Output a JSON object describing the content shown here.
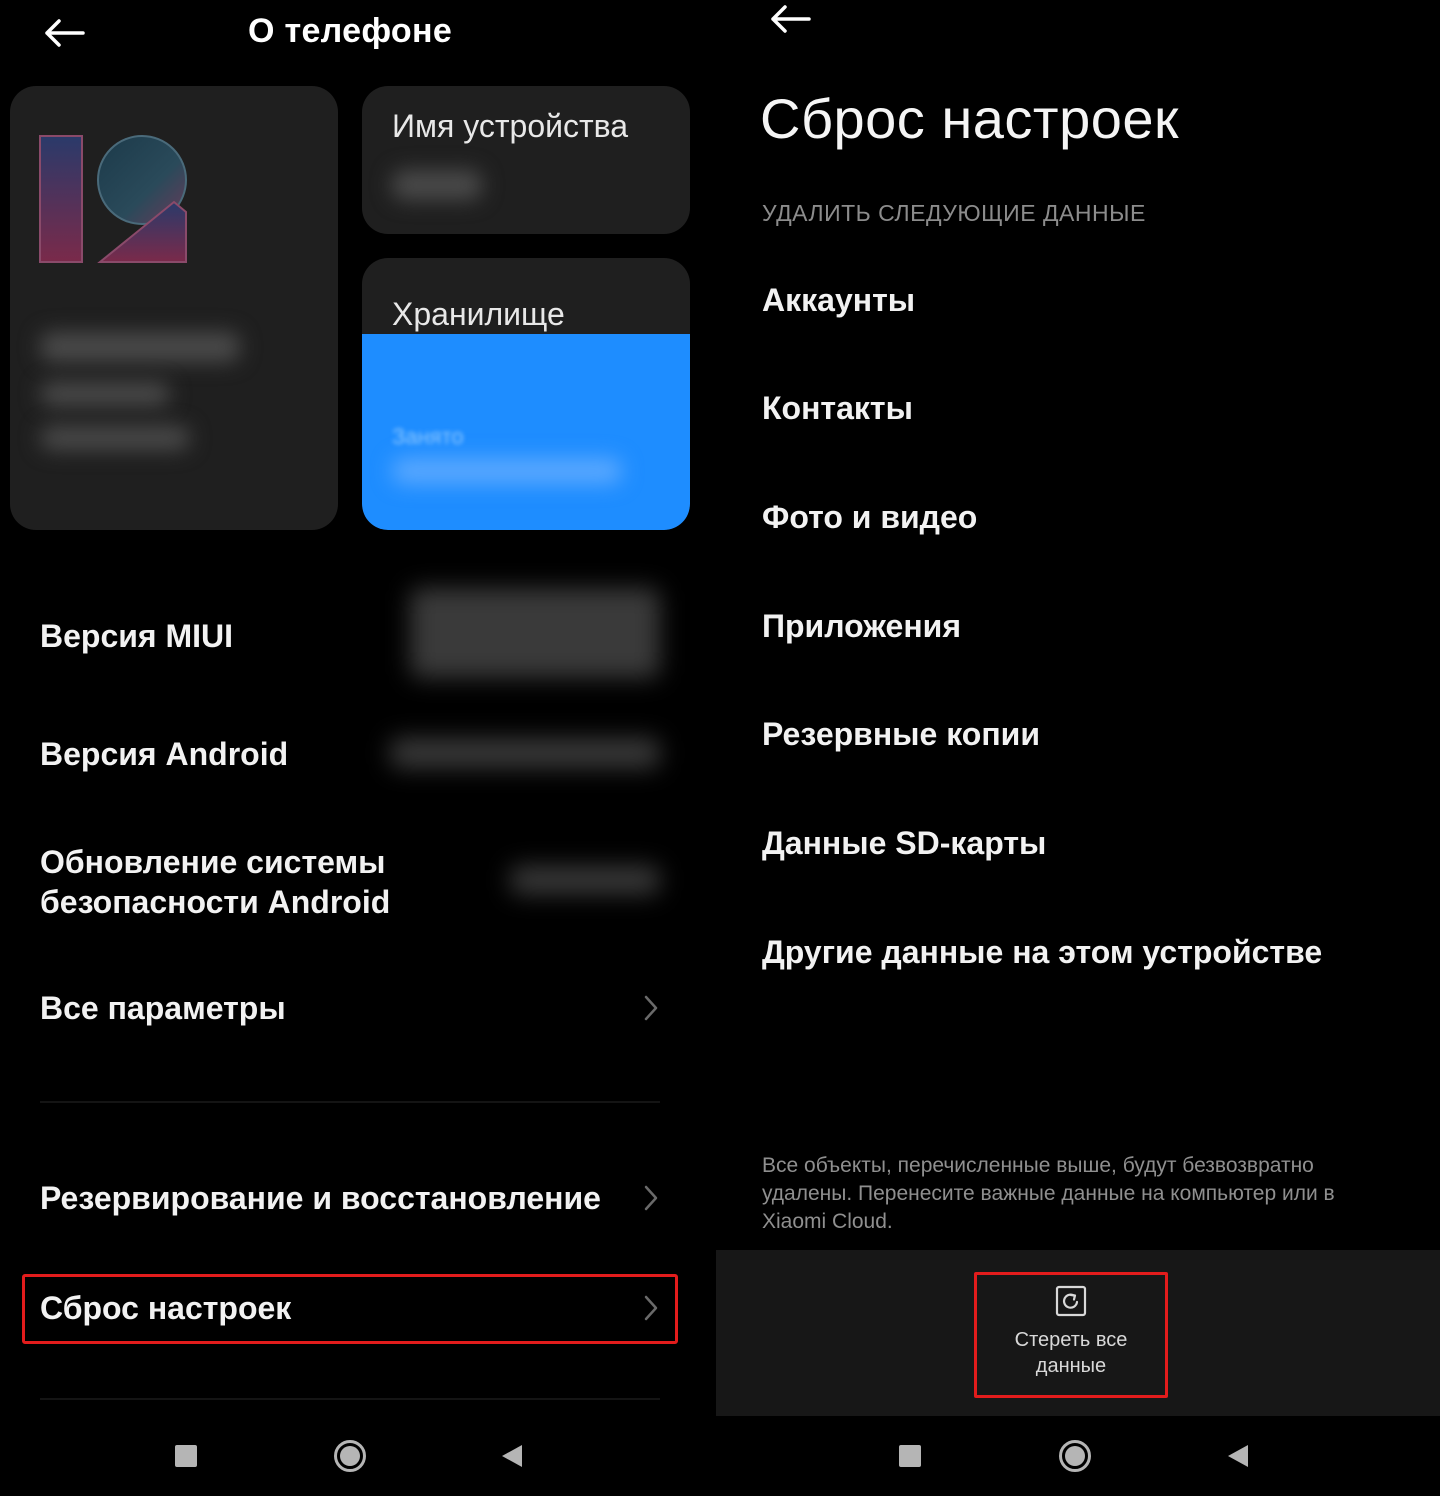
{
  "left_screen": {
    "header": {
      "title": "О телефоне"
    },
    "cards": {
      "device_name_label": "Имя устройства",
      "storage_label": "Хранилище",
      "storage_sub": "Занято"
    },
    "rows": {
      "miui_version": "Версия MIUI",
      "android_version": "Версия Android",
      "security_update": "Обновление системы безопасности Android",
      "all_params": "Все параметры",
      "backup_restore": "Резервирование и восстановление",
      "factory_reset": "Сброс настроек"
    }
  },
  "right_screen": {
    "title": "Сброс настроек",
    "section_header": "УДАЛИТЬ СЛЕДУЮЩИЕ ДАННЫЕ",
    "items": [
      "Аккаунты",
      "Контакты",
      "Фото и видео",
      "Приложения",
      "Резервные копии",
      "Данные SD-карты",
      "Другие данные на этом устройстве"
    ],
    "warning": "Все объекты, перечисленные выше, будут безвозвратно удалены. Перенесите важные данные на компьютер или в Xiaomi Cloud.",
    "erase_button": "Стереть все данные"
  },
  "colors": {
    "background": "#000000",
    "card": "#1f1f1f",
    "storage_blue": "#1e8dff",
    "highlight_red": "#e21c1c"
  },
  "icons": {
    "back": "arrow-left-icon",
    "chevron": "chevron-right-icon",
    "erase": "erase-data-icon",
    "nav_recents": "square-icon",
    "nav_home": "circle-icon",
    "nav_back": "triangle-icon"
  }
}
